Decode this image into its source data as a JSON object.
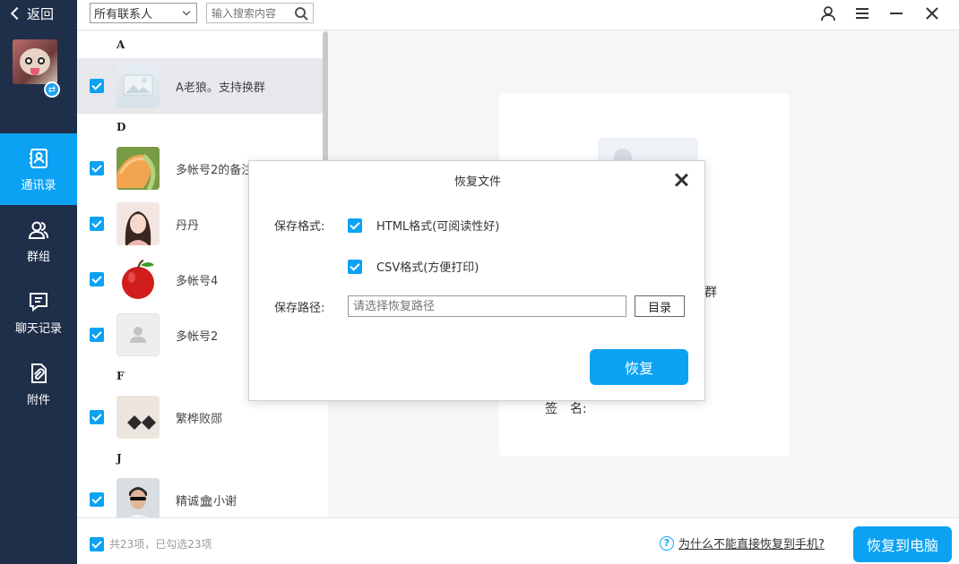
{
  "sidebar": {
    "back_label": "返回",
    "nav": [
      {
        "label": "通讯录",
        "icon": "contacts-icon",
        "active": true
      },
      {
        "label": "群组",
        "icon": "group-icon",
        "active": false
      },
      {
        "label": "聊天记录",
        "icon": "chat-icon",
        "active": false
      },
      {
        "label": "附件",
        "icon": "attachment-icon",
        "active": false
      }
    ]
  },
  "filter": {
    "selected": "所有联系人",
    "search_placeholder": "输入搜索内容"
  },
  "contacts": {
    "letters": [
      "A",
      "D",
      "F",
      "J"
    ],
    "items": [
      {
        "name": "A老狼。支持换群",
        "checked": true
      },
      {
        "name": "多帐号2的备注",
        "checked": true
      },
      {
        "name": "丹丹",
        "checked": true
      },
      {
        "name": "多帐号4",
        "checked": true
      },
      {
        "name": "多帐号2",
        "checked": true
      },
      {
        "name": "繁桦败郧",
        "checked": true
      },
      {
        "name": "精诚",
        "name_suffix": "小谢",
        "checked": true
      }
    ]
  },
  "detail": {
    "group_fragment": "群",
    "signature_label": "签　名:"
  },
  "dialog": {
    "title": "恢复文件",
    "format_label": "保存格式:",
    "option_html": "HTML格式(可阅读性好)",
    "option_csv": "CSV格式(方便打印)",
    "path_label": "保存路径:",
    "path_placeholder": "请选择恢复路径",
    "dir_button": "目录",
    "restore_button": "恢复"
  },
  "bottom": {
    "count_text": "共23项，已勾选23项",
    "help_text": "为什么不能直接恢复到手机?",
    "restore_pc_button": "恢复到电脑"
  },
  "colors": {
    "accent": "#0ba2f4",
    "sidebar_bg": "#1f2f4a"
  }
}
